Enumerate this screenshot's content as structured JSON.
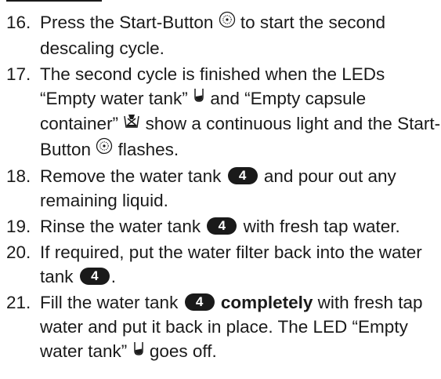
{
  "steps": [
    {
      "number": "16.",
      "parts": [
        "Press the Start-Button",
        "to start the second descaling cycle."
      ]
    },
    {
      "number": "17.",
      "parts": [
        "The second cycle is finished when the LEDs “Empty water tank”",
        "and “Empty capsule container”",
        "show a continuous light and the Start-Button",
        "flashes."
      ]
    },
    {
      "number": "18.",
      "parts": [
        "Remove the water tank",
        "and pour out any remaining liquid."
      ]
    },
    {
      "number": "19.",
      "parts": [
        "Rinse the water tank",
        "with fresh tap water."
      ]
    },
    {
      "number": "20.",
      "parts": [
        "If required, put the water filter back into the water tank",
        "."
      ]
    },
    {
      "number": "21.",
      "parts": [
        "Fill the water tank",
        "completely",
        "with fresh tap water and put it back in place. The LED “Empty water tank”",
        "goes off."
      ]
    }
  ],
  "badge_label": "4",
  "icons": [
    "start-button-icon",
    "water-tank-icon",
    "capsule-container-icon"
  ],
  "colors": {
    "text": "#1a1a1a",
    "badge_bg": "#1a1a1a",
    "badge_text": "#ffffff"
  }
}
